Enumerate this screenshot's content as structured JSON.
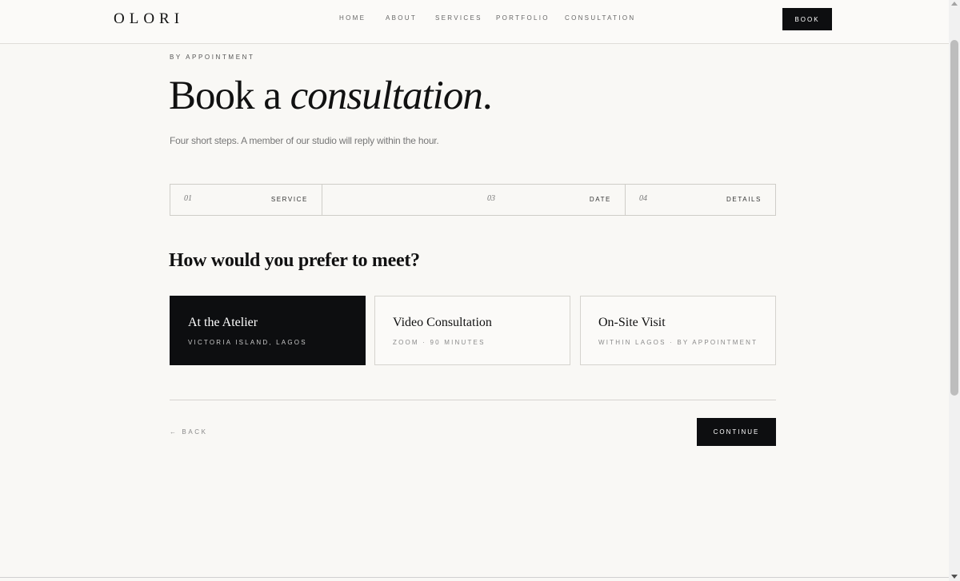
{
  "header": {
    "logo": "OLORI",
    "nav": [
      "HOME",
      "ABOUT",
      "SERVICES",
      "PORTFOLIO",
      "CONSULTATION"
    ],
    "book_label": "BOOK"
  },
  "hero": {
    "eyebrow": "BY APPOINTMENT",
    "title_start": "Book a ",
    "title_emphasis": "consultation",
    "title_end": ".",
    "subtitle": "Four short steps. A member of our studio will reply within the hour."
  },
  "steps": [
    {
      "num": "01",
      "label": "SERVICE"
    },
    {
      "num": "03",
      "label": "DATE"
    },
    {
      "num": "04",
      "label": "DETAILS"
    }
  ],
  "question": "How would you prefer to meet?",
  "options": [
    {
      "title": "At the Atelier",
      "subtitle": "VICTORIA ISLAND, LAGOS",
      "selected": true
    },
    {
      "title": "Video Consultation",
      "subtitle": "ZOOM · 90 MINUTES",
      "selected": false
    },
    {
      "title": "On-Site Visit",
      "subtitle": "WITHIN LAGOS · BY APPOINTMENT",
      "selected": false
    }
  ],
  "actions": {
    "back_label": "← BACK",
    "continue_label": "CONTINUE"
  },
  "colors": {
    "background": "#f9f8f5",
    "accent_dark": "#0d0e10"
  }
}
